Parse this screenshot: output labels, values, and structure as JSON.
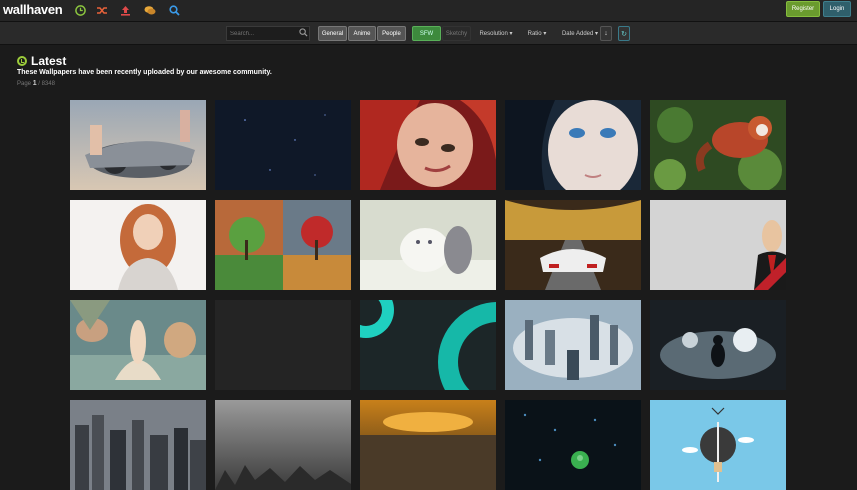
{
  "app": {
    "name": "wallhaven"
  },
  "topbar": {
    "icons": [
      {
        "name": "latest-icon",
        "glyph": "⊙",
        "color": "#8cc63f"
      },
      {
        "name": "random-icon",
        "glyph": "⤮",
        "color": "#e8623a"
      },
      {
        "name": "upload-icon",
        "glyph": "⇧",
        "color": "#e04a4a"
      },
      {
        "name": "forums-icon",
        "glyph": "◍",
        "color": "#e8a83a"
      },
      {
        "name": "search-icon",
        "glyph": "⌕",
        "color": "#3a9ae8"
      }
    ],
    "register_label": "Register",
    "login_label": "Login"
  },
  "search": {
    "placeholder": "Search...",
    "categories": [
      {
        "label": "General"
      },
      {
        "label": "Anime"
      },
      {
        "label": "People"
      }
    ],
    "purity": [
      {
        "label": "SFW"
      },
      {
        "label": "Sketchy"
      }
    ],
    "resolution_label": "Resolution",
    "ratio_label": "Ratio",
    "sort_label": "Date Added"
  },
  "main": {
    "title": "Latest",
    "subtitle": "These Wallpapers have been recently uploaded by our awesome community.",
    "page_prefix": "Page",
    "page_current": "1",
    "page_total": "/ 8348"
  },
  "corner_ribbon": "",
  "colors": {
    "accent": "#8cc63f",
    "background": "#1b1b1b",
    "register": "#6a9b2e",
    "login": "#2f5f6b"
  }
}
